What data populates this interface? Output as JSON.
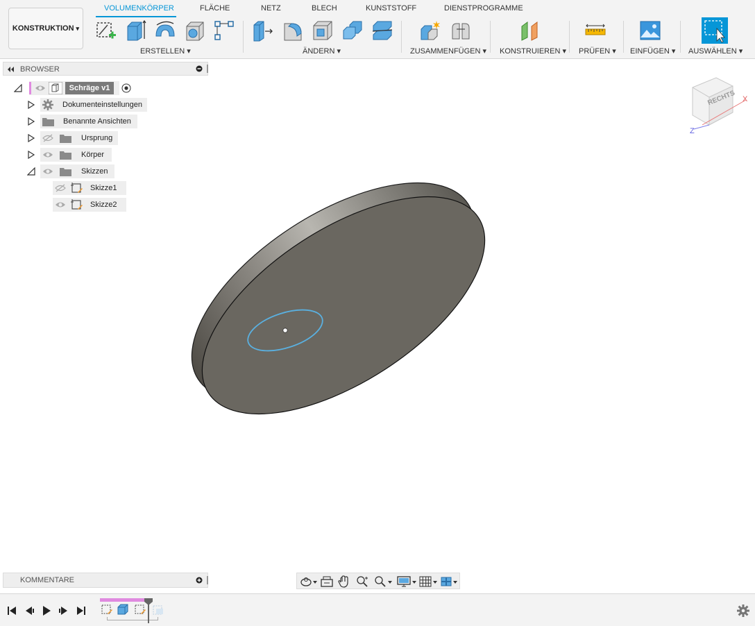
{
  "workspace": {
    "label": "KONSTRUKTION",
    "caret": "▾"
  },
  "tabs": [
    {
      "label": "VOLUMENKÖRPER",
      "active": true
    },
    {
      "label": "FLÄCHE"
    },
    {
      "label": "NETZ"
    },
    {
      "label": "BLECH"
    },
    {
      "label": "KUNSTSTOFF"
    },
    {
      "label": "DIENSTPROGRAMME"
    }
  ],
  "groups": [
    {
      "label": "ERSTELLEN ▾"
    },
    {
      "label": "ÄNDERN ▾"
    },
    {
      "label": "ZUSAMMENFÜGEN ▾"
    },
    {
      "label": "KONSTRUIEREN ▾"
    },
    {
      "label": "PRÜFEN ▾"
    },
    {
      "label": "EINFÜGEN ▾"
    },
    {
      "label": "AUSWÄHLEN ▾"
    }
  ],
  "browser": {
    "title": "BROWSER",
    "root": {
      "label": "Schräge v1"
    },
    "items": [
      {
        "label": "Dokumenteinstellungen"
      },
      {
        "label": "Benannte Ansichten"
      },
      {
        "label": "Ursprung"
      },
      {
        "label": "Körper"
      },
      {
        "label": "Skizzen"
      },
      {
        "label": "Skizze1"
      },
      {
        "label": "Skizze2"
      }
    ]
  },
  "viewcube": {
    "face": "RECHTS",
    "axis_x": "X",
    "axis_z": "Z"
  },
  "comments": {
    "title": "KOMMENTARE"
  },
  "colors": {
    "accent": "#0696d7",
    "body": "#6a6760",
    "sketch": "#5ab0e0",
    "timeline_marker": "#e08ae0"
  },
  "icons": [
    "orbit-icon",
    "look-at-icon",
    "pan-icon",
    "zoom-window-icon",
    "zoom-icon",
    "display-settings-icon",
    "grid-icon",
    "viewports-icon"
  ]
}
